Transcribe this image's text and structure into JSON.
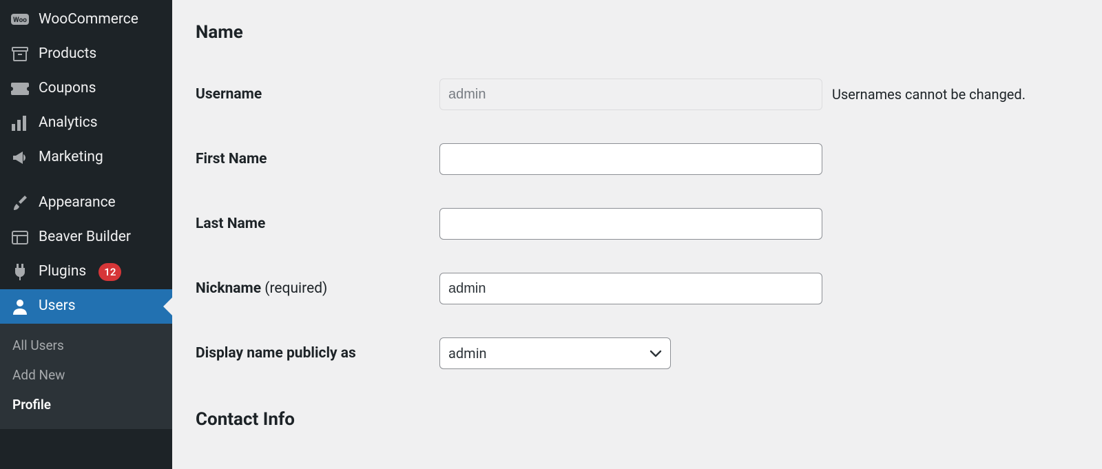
{
  "sidebar": {
    "items": [
      {
        "id": "woocommerce",
        "label": "WooCommerce",
        "icon": "woo-icon"
      },
      {
        "id": "products",
        "label": "Products",
        "icon": "archive-icon"
      },
      {
        "id": "coupons",
        "label": "Coupons",
        "icon": "ticket-icon"
      },
      {
        "id": "analytics",
        "label": "Analytics",
        "icon": "chart-icon"
      },
      {
        "id": "marketing",
        "label": "Marketing",
        "icon": "megaphone-icon"
      },
      {
        "id": "appearance",
        "label": "Appearance",
        "icon": "brush-icon"
      },
      {
        "id": "beaver",
        "label": "Beaver Builder",
        "icon": "layout-icon"
      },
      {
        "id": "plugins",
        "label": "Plugins",
        "icon": "plug-icon",
        "badge": "12"
      },
      {
        "id": "users",
        "label": "Users",
        "icon": "user-icon",
        "active": true
      }
    ],
    "submenu": [
      {
        "id": "all-users",
        "label": "All Users"
      },
      {
        "id": "add-new",
        "label": "Add New"
      },
      {
        "id": "profile",
        "label": "Profile",
        "current": true
      }
    ]
  },
  "form": {
    "section_name": "Name",
    "section_contact": "Contact Info",
    "username_label": "Username",
    "username_value": "admin",
    "username_hint": "Usernames cannot be changed.",
    "first_name_label": "First Name",
    "first_name_value": "",
    "last_name_label": "Last Name",
    "last_name_value": "",
    "nickname_label": "Nickname ",
    "nickname_required": "(required)",
    "nickname_value": "admin",
    "display_label": "Display name publicly as",
    "display_value": "admin"
  }
}
